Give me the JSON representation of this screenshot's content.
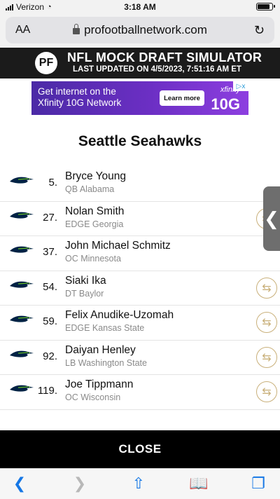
{
  "status_bar": {
    "carrier": "Verizon",
    "time": "3:18 AM"
  },
  "browser": {
    "aa": "AA",
    "url": "profootballnetwork.com",
    "reload": "↻"
  },
  "site_header": {
    "logo": "PF",
    "title": "NFL MOCK DRAFT SIMULATOR",
    "updated": "LAST UPDATED ON 4/5/2023, 7:51:16 AM ET"
  },
  "ad": {
    "text_line1": "Get internet on the",
    "text_line2": "Xfinity 10G Network",
    "button": "Learn more",
    "brand": "xfinity",
    "brand_product": "10G",
    "adchoice": "▷x"
  },
  "team": {
    "name": "Seattle Seahawks"
  },
  "picks": [
    {
      "number": "5.",
      "name": "Bryce Young",
      "info": "QB Alabama"
    },
    {
      "number": "27.",
      "name": "Nolan Smith",
      "info": "EDGE Georgia"
    },
    {
      "number": "37.",
      "name": "John Michael Schmitz",
      "info": "OC Minnesota"
    },
    {
      "number": "54.",
      "name": "Siaki Ika",
      "info": "DT Baylor"
    },
    {
      "number": "59.",
      "name": "Felix Anudike-Uzomah",
      "info": "EDGE Kansas State"
    },
    {
      "number": "92.",
      "name": "Daiyan Henley",
      "info": "LB Washington State"
    },
    {
      "number": "119.",
      "name": "Joe Tippmann",
      "info": "OC Wisconsin"
    }
  ],
  "icons": {
    "swap": "⇆",
    "side_tab": "❮",
    "back": "❮",
    "forward": "❯",
    "share": "⇧",
    "bookmarks": "📖",
    "tabs": "❐"
  },
  "close_label": "CLOSE",
  "colors": {
    "header_bg": "#1b1b1b",
    "swap_gold": "#c9b07a",
    "ios_blue": "#1677e5",
    "seahawks_navy": "#002244",
    "seahawks_green": "#69be28"
  }
}
